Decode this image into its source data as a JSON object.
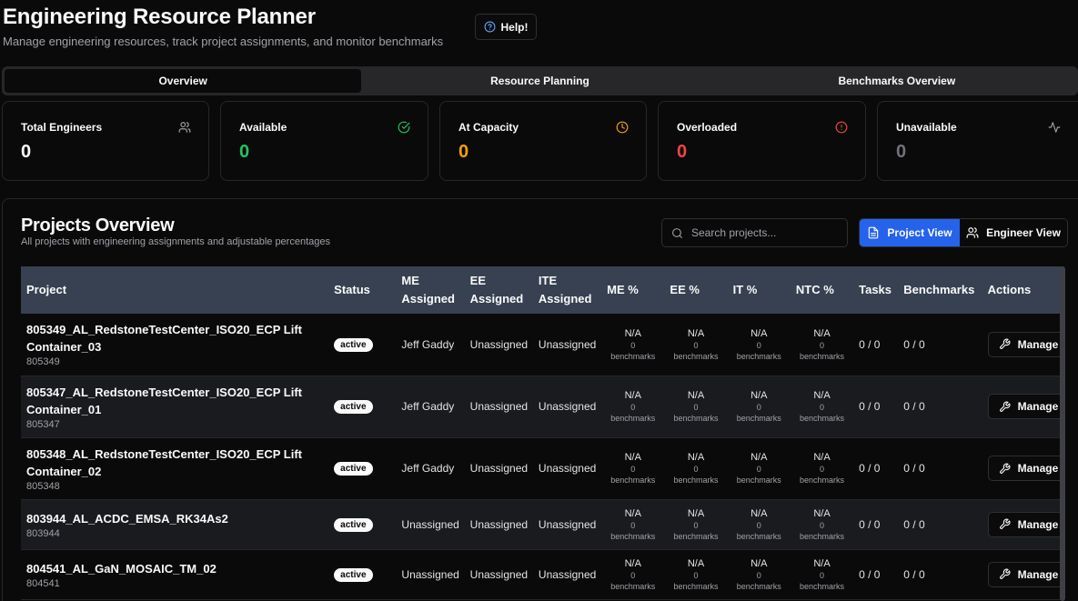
{
  "header": {
    "title": "Engineering Resource Planner",
    "subtitle": "Manage engineering resources, track project assignments, and monitor benchmarks",
    "help_label": "Help!"
  },
  "tabs": [
    {
      "label": "Overview",
      "active": true
    },
    {
      "label": "Resource Planning",
      "active": false
    },
    {
      "label": "Benchmarks Overview",
      "active": false
    }
  ],
  "stats": [
    {
      "label": "Total Engineers",
      "value": "0",
      "color": "#fafafa",
      "icon": "users-icon"
    },
    {
      "label": "Available",
      "value": "0",
      "color": "#22c55e",
      "icon": "check-circle-icon"
    },
    {
      "label": "At Capacity",
      "value": "0",
      "color": "#f59e0b",
      "icon": "clock-icon"
    },
    {
      "label": "Overloaded",
      "value": "0",
      "color": "#ef4444",
      "icon": "alert-circle-icon"
    },
    {
      "label": "Unavailable",
      "value": "0",
      "color": "#71717a",
      "icon": "activity-icon"
    }
  ],
  "projects": {
    "title": "Projects Overview",
    "subtitle": "All projects with engineering assignments and adjustable percentages",
    "search_placeholder": "Search projects...",
    "view_project_label": "Project View",
    "view_engineer_label": "Engineer View",
    "accent": "#2563eb",
    "columns": [
      "Project",
      "Status",
      "ME Assigned",
      "EE Assigned",
      "ITE Assigned",
      "ME %",
      "EE %",
      "IT %",
      "NTC %",
      "Tasks",
      "Benchmarks",
      "Actions"
    ],
    "pct_na": "N/A",
    "pct_count": "0",
    "pct_unit": "benchmarks",
    "manage_label": "Manage",
    "rows": [
      {
        "name": "805349_AL_RedstoneTestCenter_ISO20_ECP Lift Container_03",
        "id": "805349",
        "status": "active",
        "me": "Jeff Gaddy",
        "ee": "Unassigned",
        "ite": "Unassigned",
        "tasks": "0 / 0",
        "benchmarks": "0 / 0"
      },
      {
        "name": "805347_AL_RedstoneTestCenter_ISO20_ECP Lift Container_01",
        "id": "805347",
        "status": "active",
        "me": "Jeff Gaddy",
        "ee": "Unassigned",
        "ite": "Unassigned",
        "tasks": "0 / 0",
        "benchmarks": "0 / 0"
      },
      {
        "name": "805348_AL_RedstoneTestCenter_ISO20_ECP Lift Container_02",
        "id": "805348",
        "status": "active",
        "me": "Jeff Gaddy",
        "ee": "Unassigned",
        "ite": "Unassigned",
        "tasks": "0 / 0",
        "benchmarks": "0 / 0"
      },
      {
        "name": "803944_AL_ACDC_EMSA_RK34As2",
        "id": "803944",
        "status": "active",
        "me": "Unassigned",
        "ee": "Unassigned",
        "ite": "Unassigned",
        "tasks": "0 / 0",
        "benchmarks": "0 / 0"
      },
      {
        "name": "804541_AL_GaN_MOSAIC_TM_02",
        "id": "804541",
        "status": "active",
        "me": "Unassigned",
        "ee": "Unassigned",
        "ite": "Unassigned",
        "tasks": "0 / 0",
        "benchmarks": "0 / 0"
      }
    ]
  }
}
